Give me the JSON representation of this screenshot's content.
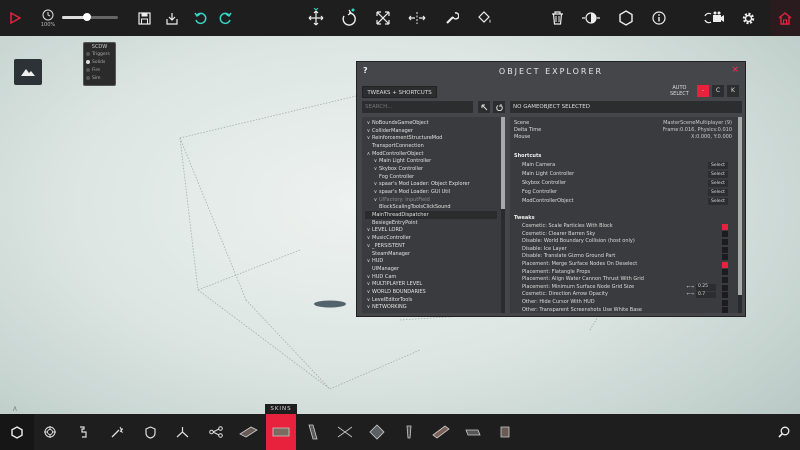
{
  "toolbar": {
    "icons": [
      "play-icon",
      "clock-icon",
      "save-icon",
      "import-icon",
      "undo-icon",
      "redo-icon",
      "move-icon",
      "rotate-icon",
      "scale-icon",
      "flip-icon",
      "wrench-icon",
      "paint-bucket-icon",
      "delete-icon",
      "simulate-icon",
      "hexagon-icon",
      "info-icon",
      "camera-icon",
      "settings-icon",
      "home-icon"
    ],
    "time_scale": "100%",
    "time_scale_fraction": 0.45,
    "accent": "#e8213d"
  },
  "scdw": {
    "title": "SCDW",
    "options": [
      {
        "label": "Triggers",
        "on": false
      },
      {
        "label": "Solids",
        "on": true
      },
      {
        "label": "Fire",
        "on": false
      },
      {
        "label": "Sim",
        "on": false
      }
    ]
  },
  "explorer": {
    "help": "?",
    "title": "OBJECT EXPLORER",
    "close": "×",
    "tweaks_button": "TWEAKS + SHORTCUTS",
    "auto_select_line1": "AUTO",
    "auto_select_line2": "SELECT",
    "mode_red": "-",
    "mode_c": "C",
    "mode_k": "K",
    "search_placeholder": "SEARCH...",
    "selection_status": "NO GAMEOBJECT SELECTED",
    "tree": [
      {
        "label": "NoBoundsGameObject",
        "arrow": "∨",
        "indent": 0
      },
      {
        "label": "ColliderManager",
        "arrow": "∨",
        "indent": 0
      },
      {
        "label": "ReinforcementStructureMod",
        "arrow": "∨",
        "indent": 0
      },
      {
        "label": "TransportConnection",
        "arrow": "",
        "indent": 0
      },
      {
        "label": "ModControllerObject",
        "arrow": "∧",
        "indent": 0
      },
      {
        "label": "Main Light Controller",
        "arrow": "∨",
        "indent": 1
      },
      {
        "label": "Skybox Controller",
        "arrow": "∨",
        "indent": 1
      },
      {
        "label": "Fog Controller",
        "arrow": "",
        "indent": 1
      },
      {
        "label": "spaar's Mod Loader: Object Explorer",
        "arrow": "∨",
        "indent": 1
      },
      {
        "label": "spaar's Mod Loader: GUI Util",
        "arrow": "∨",
        "indent": 1
      },
      {
        "label": "UIFactory: InputField",
        "arrow": "∨",
        "indent": 1,
        "dim": true
      },
      {
        "label": "BlockScalingToolsClickSound",
        "arrow": "",
        "indent": 1
      },
      {
        "label": "MainThreadDispatcher",
        "arrow": "",
        "indent": 0,
        "selected": true
      },
      {
        "label": "BesiegeEntryPoint",
        "arrow": "",
        "indent": 0
      },
      {
        "label": "LEVEL LORD",
        "arrow": "∨",
        "indent": 0
      },
      {
        "label": "MusicController",
        "arrow": "∨",
        "indent": 0
      },
      {
        "label": "_PERSISTENT",
        "arrow": "∨",
        "indent": 0
      },
      {
        "label": "SteamManager",
        "arrow": "",
        "indent": 0
      },
      {
        "label": "HUD",
        "arrow": "∨",
        "indent": 0
      },
      {
        "label": "UIManager",
        "arrow": "",
        "indent": 0
      },
      {
        "label": "HUD Cam",
        "arrow": "∨",
        "indent": 0
      },
      {
        "label": "MULTIPLAYER LEVEL",
        "arrow": "∨",
        "indent": 0
      },
      {
        "label": "WORLD BOUNDARIES",
        "arrow": "∨",
        "indent": 0
      },
      {
        "label": "LevelEditorTools",
        "arrow": "∨",
        "indent": 0
      },
      {
        "label": "NETWORKING",
        "arrow": "∨",
        "indent": 0
      }
    ],
    "info": [
      {
        "label": "Scene",
        "value": "MasterSceneMultiplayer (9)"
      },
      {
        "label": "Delta Time",
        "value": "Frame:0.016, Physics:0.010"
      },
      {
        "label": "Mouse",
        "value": "X:0.000, Y:0.000"
      }
    ],
    "shortcuts_header": "Shortcuts",
    "shortcuts": [
      {
        "label": "Main Camera",
        "button": "Select"
      },
      {
        "label": "Main Light Controller",
        "button": "Select"
      },
      {
        "label": "Skybox Controller",
        "button": "Select"
      },
      {
        "label": "Fog Controller",
        "button": "Select"
      },
      {
        "label": "ModControllerObject",
        "button": "Select"
      }
    ],
    "tweaks_header": "Tweaks",
    "tweaks": [
      {
        "label": "Cosmetic: Scale Particles With Block",
        "on": true
      },
      {
        "label": "Cosmetic: Clearer Barren Sky",
        "on": false
      },
      {
        "label": "Disable: World Boundary Collision (host only)",
        "on": false
      },
      {
        "label": "Disable: Ice Layer",
        "on": false
      },
      {
        "label": "Disable: Translate Gizmo Ground Part",
        "on": false
      },
      {
        "label": "Placement: Merge Surface Nodes On Deselect",
        "on": true
      },
      {
        "label": "Placement: Flatangle Props",
        "on": false
      },
      {
        "label": "Placement: Align Water Cannon Thrust With Grid",
        "on": false
      },
      {
        "label": "Placement: Minimum Surface Node Grid Size",
        "number": "0.25",
        "arrows": "←→"
      },
      {
        "label": "Cosmetic: Direction Arrow Opacity",
        "number": "0.7",
        "arrows": "←→"
      },
      {
        "label": "Other: Hide Cursor With HUD",
        "on": false
      },
      {
        "label": "Other: Transparent Screenshots Use White Base",
        "on": false
      }
    ]
  },
  "bottombar": {
    "skins_label": "SKINS",
    "tools": [
      "hexagon-icon",
      "target-icon",
      "pipette-icon",
      "wand-icon",
      "shield-icon",
      "tripod-icon",
      "nodes-icon"
    ],
    "skins_count": 9,
    "active_skin_index": 1
  }
}
